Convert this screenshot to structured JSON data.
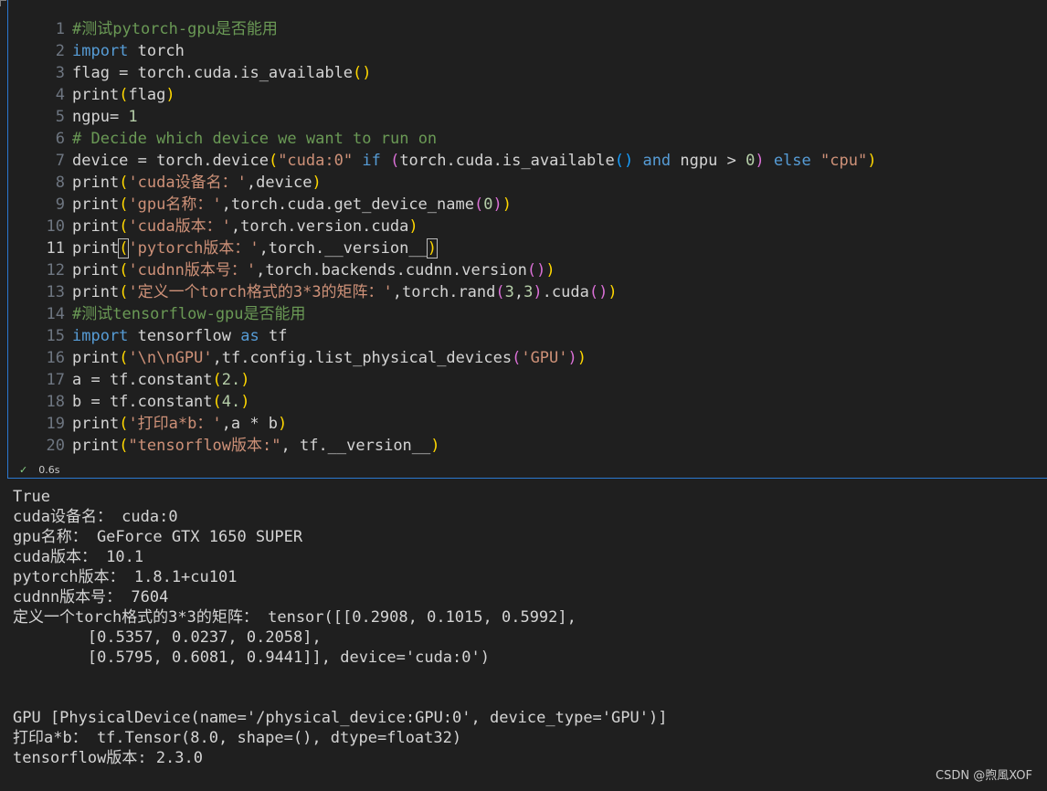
{
  "cell": {
    "lines": [
      {
        "num": "1",
        "tokens": [
          [
            "#测试pytorch-gpu是否能用",
            "c"
          ]
        ]
      },
      {
        "num": "2",
        "tokens": [
          [
            "import",
            "kw"
          ],
          [
            " torch",
            "t"
          ]
        ]
      },
      {
        "num": "3",
        "tokens": [
          [
            "flag = torch.cuda.is_available",
            "t"
          ],
          [
            "()",
            "b1"
          ]
        ]
      },
      {
        "num": "4",
        "tokens": [
          [
            "print",
            "t"
          ],
          [
            "(",
            "b1"
          ],
          [
            "flag",
            "t"
          ],
          [
            ")",
            "b1"
          ]
        ]
      },
      {
        "num": "5",
        "tokens": [
          [
            "ngpu= ",
            "t"
          ],
          [
            "1",
            "n"
          ]
        ]
      },
      {
        "num": "6",
        "tokens": [
          [
            "# Decide which device we want to run on",
            "c"
          ]
        ]
      },
      {
        "num": "7",
        "tokens": [
          [
            "device = torch.device",
            "t"
          ],
          [
            "(",
            "b1"
          ],
          [
            "\"cuda:0\"",
            "s"
          ],
          [
            " ",
            "t"
          ],
          [
            "if",
            "kw"
          ],
          [
            " ",
            "t"
          ],
          [
            "(",
            "b2"
          ],
          [
            "torch.cuda.is_available",
            "t"
          ],
          [
            "()",
            "b3"
          ],
          [
            " ",
            "t"
          ],
          [
            "and",
            "kw"
          ],
          [
            " ngpu > ",
            "t"
          ],
          [
            "0",
            "n"
          ],
          [
            ")",
            "b2"
          ],
          [
            " ",
            "t"
          ],
          [
            "else",
            "kw"
          ],
          [
            " ",
            "t"
          ],
          [
            "\"cpu\"",
            "s"
          ],
          [
            ")",
            "b1"
          ]
        ]
      },
      {
        "num": "8",
        "tokens": [
          [
            "print",
            "t"
          ],
          [
            "(",
            "b1"
          ],
          [
            "'cuda设备名：'",
            "s"
          ],
          [
            ",device",
            "t"
          ],
          [
            ")",
            "b1"
          ]
        ]
      },
      {
        "num": "9",
        "tokens": [
          [
            "print",
            "t"
          ],
          [
            "(",
            "b1"
          ],
          [
            "'gpu名称：'",
            "s"
          ],
          [
            ",torch.cuda.get_device_name",
            "t"
          ],
          [
            "(",
            "b2"
          ],
          [
            "0",
            "n"
          ],
          [
            ")",
            "b2"
          ],
          [
            ")",
            "b1"
          ]
        ]
      },
      {
        "num": "10",
        "tokens": [
          [
            "print",
            "t"
          ],
          [
            "(",
            "b1"
          ],
          [
            "'cuda版本：'",
            "s"
          ],
          [
            ",torch.version.cuda",
            "t"
          ],
          [
            ")",
            "b1"
          ]
        ]
      },
      {
        "num": "11",
        "active": true,
        "tokens": [
          [
            "print",
            "t"
          ],
          [
            "(",
            "b1 cursor-box"
          ],
          [
            "'pytorch版本：'",
            "s"
          ],
          [
            ",torch.__version__",
            "t"
          ],
          [
            ")",
            "b1 cursor-box"
          ]
        ]
      },
      {
        "num": "12",
        "tokens": [
          [
            "print",
            "t"
          ],
          [
            "(",
            "b1"
          ],
          [
            "'cudnn版本号：'",
            "s"
          ],
          [
            ",torch.backends.cudnn.version",
            "t"
          ],
          [
            "()",
            "b2"
          ],
          [
            ")",
            "b1"
          ]
        ]
      },
      {
        "num": "13",
        "tokens": [
          [
            "print",
            "t"
          ],
          [
            "(",
            "b1"
          ],
          [
            "'定义一个torch格式的3*3的矩阵：'",
            "s"
          ],
          [
            ",torch.rand",
            "t"
          ],
          [
            "(",
            "b2"
          ],
          [
            "3",
            "n"
          ],
          [
            ",",
            "t"
          ],
          [
            "3",
            "n"
          ],
          [
            ")",
            "b2"
          ],
          [
            ".cuda",
            "t"
          ],
          [
            "()",
            "b2"
          ],
          [
            ")",
            "b1"
          ]
        ]
      },
      {
        "num": "14",
        "tokens": [
          [
            "#测试tensorflow-gpu是否能用",
            "c"
          ]
        ]
      },
      {
        "num": "15",
        "tokens": [
          [
            "import",
            "kw"
          ],
          [
            " tensorflow ",
            "t"
          ],
          [
            "as",
            "kw"
          ],
          [
            " tf",
            "t"
          ]
        ]
      },
      {
        "num": "16",
        "tokens": [
          [
            "print",
            "t"
          ],
          [
            "(",
            "b1"
          ],
          [
            "'\\n\\nGPU'",
            "s"
          ],
          [
            ",tf.config.list_physical_devices",
            "t"
          ],
          [
            "(",
            "b2"
          ],
          [
            "'GPU'",
            "s"
          ],
          [
            ")",
            "b2"
          ],
          [
            ")",
            "b1"
          ]
        ]
      },
      {
        "num": "17",
        "tokens": [
          [
            "a = tf.constant",
            "t"
          ],
          [
            "(",
            "b1"
          ],
          [
            "2.",
            "n"
          ],
          [
            ")",
            "b1"
          ]
        ]
      },
      {
        "num": "18",
        "tokens": [
          [
            "b = tf.constant",
            "t"
          ],
          [
            "(",
            "b1"
          ],
          [
            "4.",
            "n"
          ],
          [
            ")",
            "b1"
          ]
        ]
      },
      {
        "num": "19",
        "tokens": [
          [
            "print",
            "t"
          ],
          [
            "(",
            "b1"
          ],
          [
            "'打印a*b：'",
            "s"
          ],
          [
            ",a * b",
            "t"
          ],
          [
            ")",
            "b1"
          ]
        ]
      },
      {
        "num": "20",
        "tokens": [
          [
            "print",
            "t"
          ],
          [
            "(",
            "b1"
          ],
          [
            "\"tensorflow版本:\"",
            "s"
          ],
          [
            ", tf.__version__",
            "t"
          ],
          [
            ")",
            "b1"
          ]
        ]
      }
    ],
    "status": {
      "check_icon": "✓",
      "time": "0.6s"
    }
  },
  "output": {
    "lines": [
      "True",
      "cuda设备名： cuda:0",
      "gpu名称： GeForce GTX 1650 SUPER",
      "cuda版本： 10.1",
      "pytorch版本： 1.8.1+cu101",
      "cudnn版本号： 7604",
      "定义一个torch格式的3*3的矩阵： tensor([[0.2908, 0.1015, 0.5992],",
      "        [0.5357, 0.0237, 0.2058],",
      "        [0.5795, 0.6081, 0.9441]], device='cuda:0')",
      "",
      "",
      "GPU [PhysicalDevice(name='/physical_device:GPU:0', device_type='GPU')]",
      "打印a*b： tf.Tensor(8.0, shape=(), dtype=float32)",
      "tensorflow版本: 2.3.0"
    ]
  },
  "watermark": "CSDN @煦風XOF"
}
